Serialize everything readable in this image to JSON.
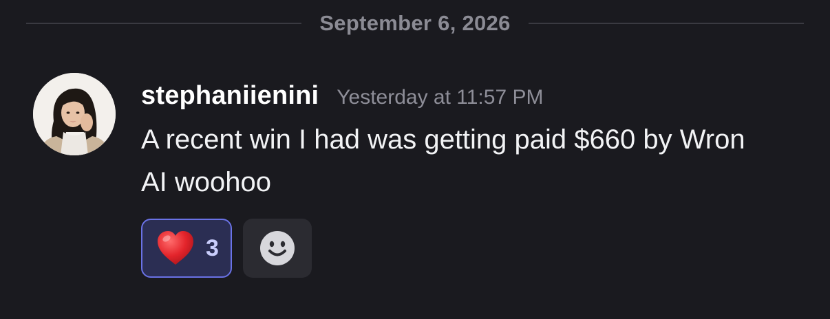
{
  "date_divider": {
    "label": "September 6, 2026"
  },
  "message": {
    "author": "stephaniienini",
    "timestamp": "Yesterday at 11:57 PM",
    "text": "A recent win I had was getting paid $660 by Wron AI woohoo",
    "avatar_icon": "user-avatar-photo"
  },
  "reactions": [
    {
      "emoji_icon": "red-heart-icon",
      "count": "3",
      "selected": true
    }
  ],
  "add_reaction": {
    "icon": "smiley-face-icon"
  },
  "colors": {
    "background": "#1a1a1f",
    "reaction_border": "#6a72e6",
    "reaction_fill": "#2b2e53",
    "muted_text": "#8e8e98"
  }
}
